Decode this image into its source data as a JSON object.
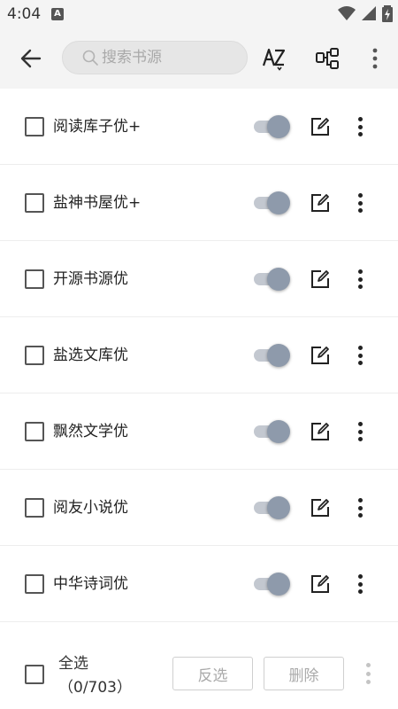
{
  "status_bar": {
    "time": "4:04",
    "notification_badge": "A"
  },
  "toolbar": {
    "search_placeholder": "搜索书源",
    "sort_icon_label": "AZ"
  },
  "sources": [
    {
      "name": "阅读库子优+",
      "checked": false,
      "enabled": true
    },
    {
      "name": "盐神书屋优+",
      "checked": false,
      "enabled": true
    },
    {
      "name": "开源书源优",
      "checked": false,
      "enabled": true
    },
    {
      "name": "盐选文库优",
      "checked": false,
      "enabled": true
    },
    {
      "name": "飘然文学优",
      "checked": false,
      "enabled": true
    },
    {
      "name": "阅友小说优",
      "checked": false,
      "enabled": true
    },
    {
      "name": "中华诗词优",
      "checked": false,
      "enabled": true
    }
  ],
  "bottom_bar": {
    "select_all_label": "全选",
    "selection_count": "（0/703）",
    "invert_label": "反选",
    "delete_label": "删除"
  },
  "colors": {
    "toolbar_bg": "#f4f4f4",
    "switch_thumb": "#8e9aab",
    "switch_track": "#c3c8d0"
  }
}
